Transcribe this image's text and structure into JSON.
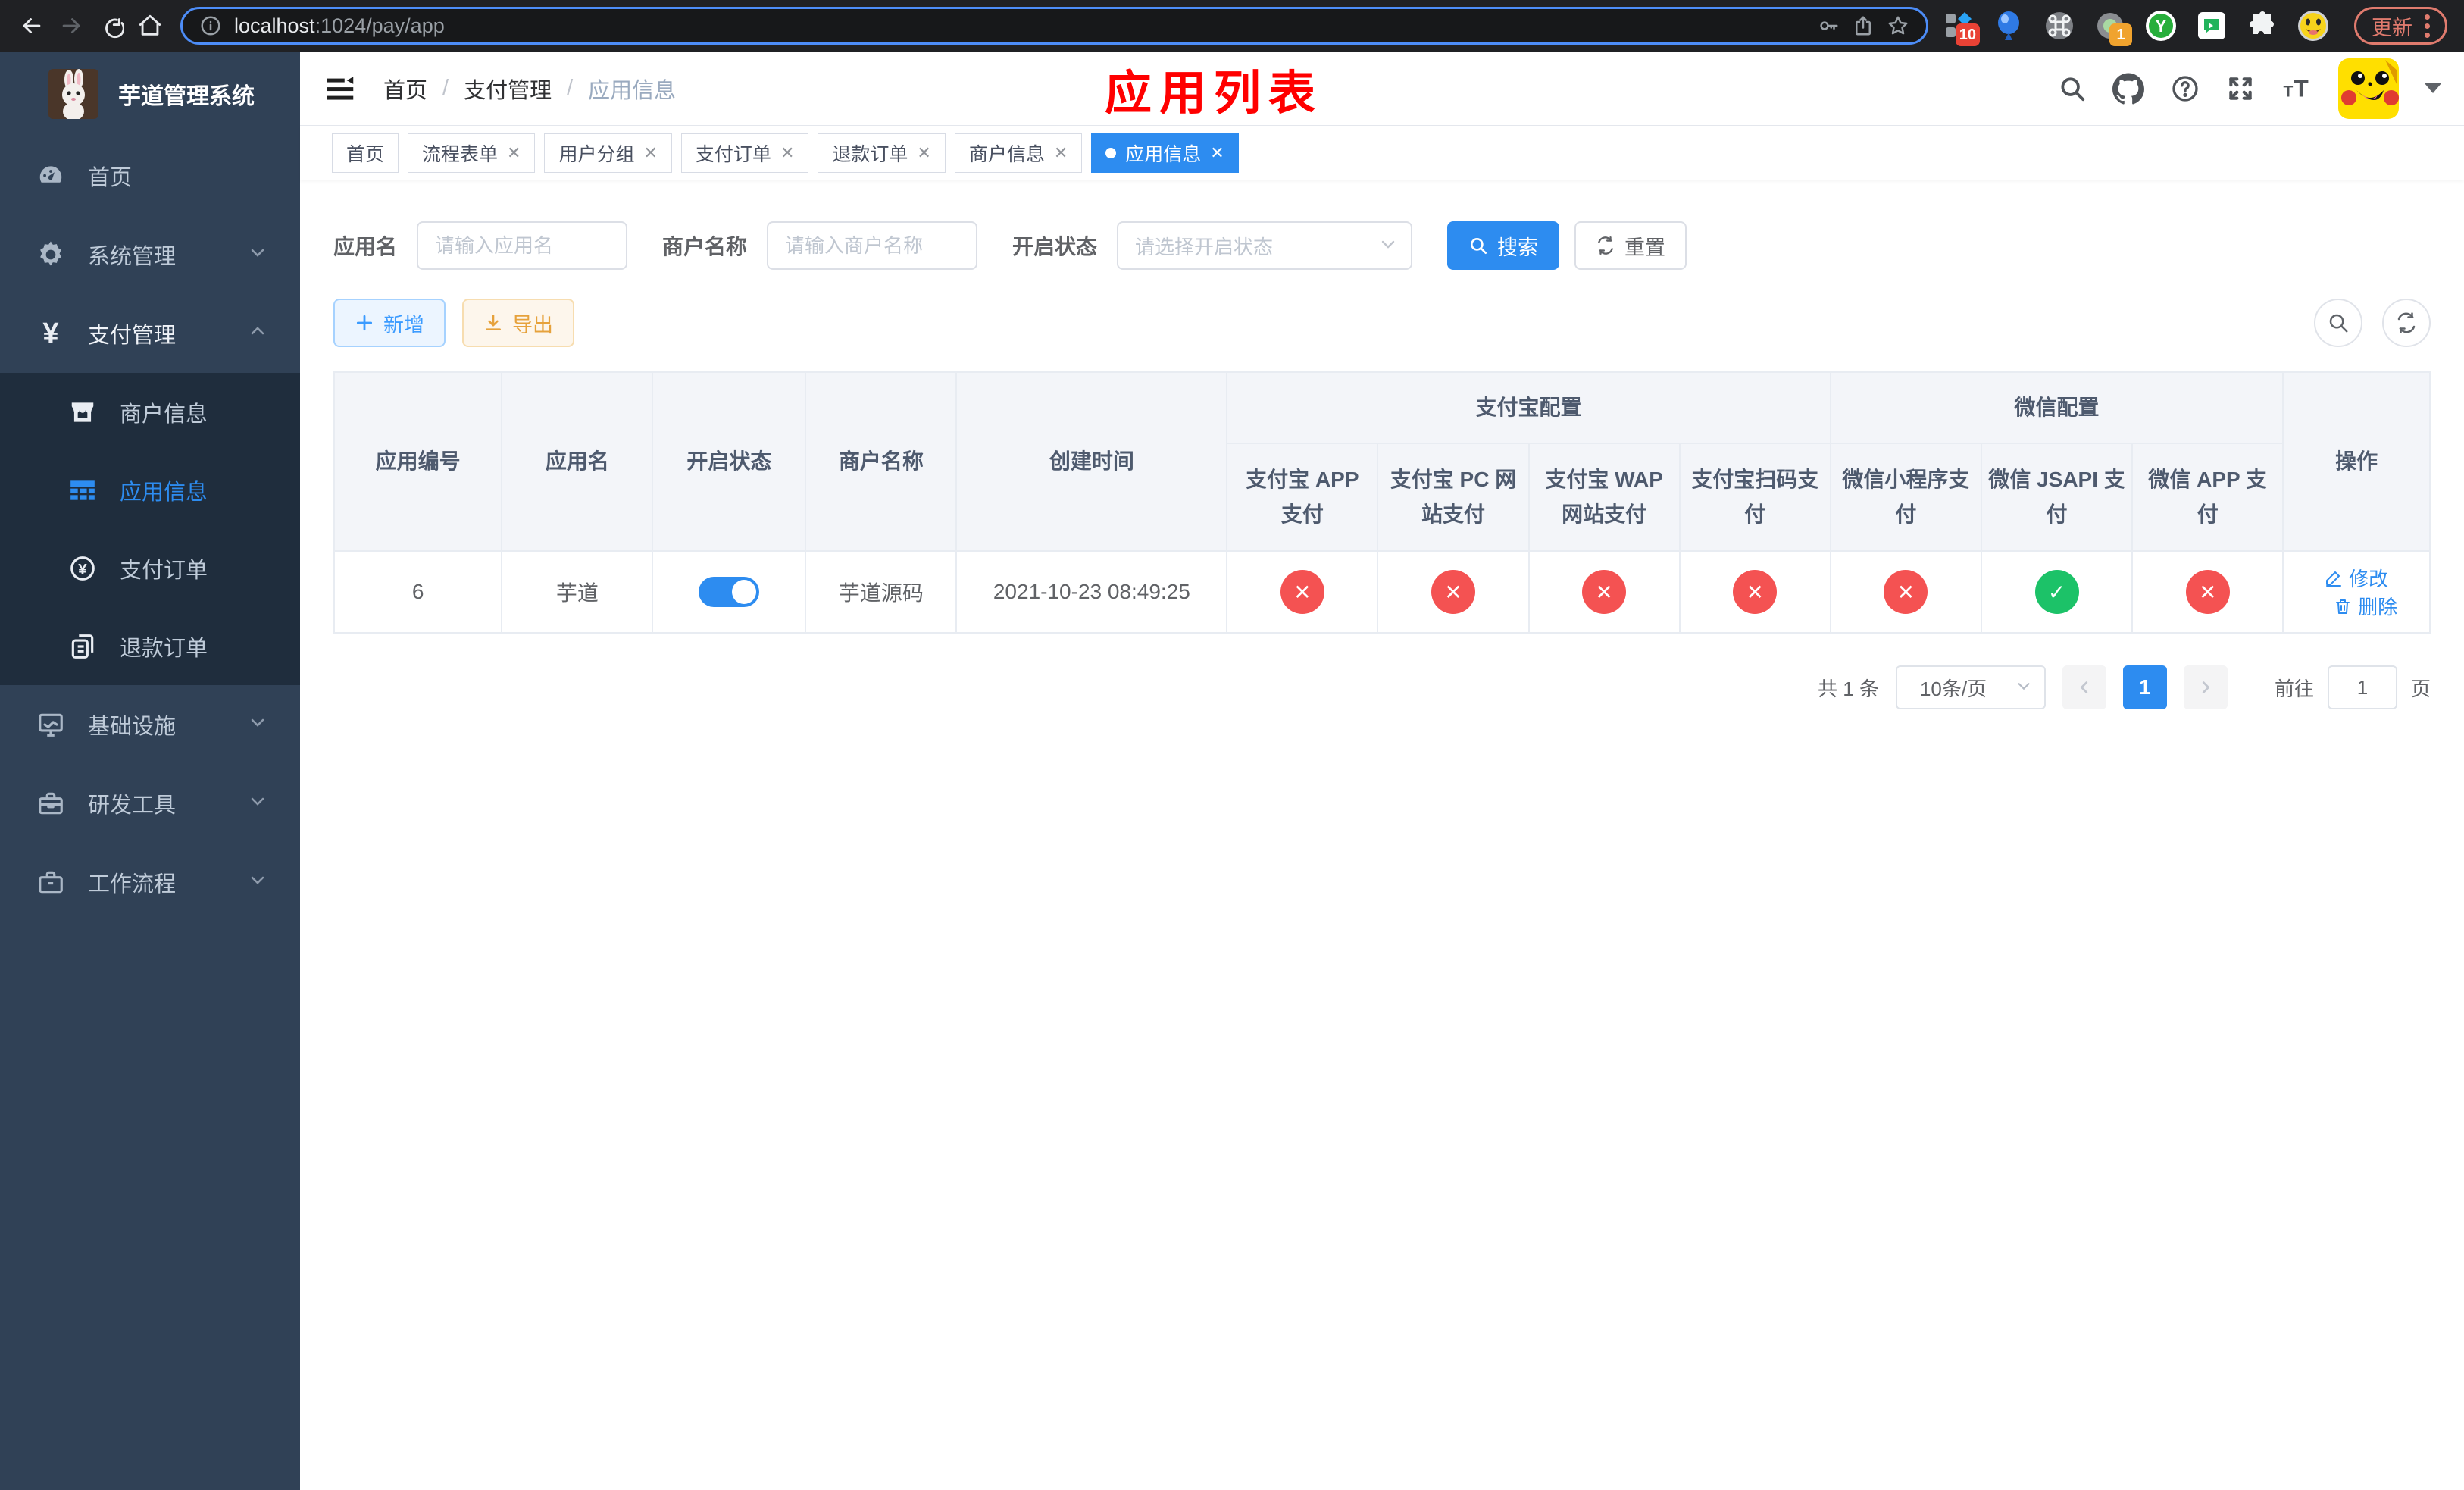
{
  "browser": {
    "url_host": "localhost",
    "url_rest": ":1024/pay/app",
    "ext_badge_10": "10",
    "ext_badge_1": "1",
    "update_label": "更新"
  },
  "sidebar": {
    "title": "芋道管理系统",
    "menu": [
      {
        "label": "首页"
      },
      {
        "label": "系统管理"
      },
      {
        "label": "支付管理"
      },
      {
        "label": "商户信息"
      },
      {
        "label": "应用信息"
      },
      {
        "label": "支付订单"
      },
      {
        "label": "退款订单"
      },
      {
        "label": "基础设施"
      },
      {
        "label": "研发工具"
      },
      {
        "label": "工作流程"
      }
    ]
  },
  "header": {
    "breadcrumb": [
      "首页",
      "支付管理",
      "应用信息"
    ],
    "annotation": "应用列表"
  },
  "tabs": [
    {
      "label": "首页"
    },
    {
      "label": "流程表单"
    },
    {
      "label": "用户分组"
    },
    {
      "label": "支付订单"
    },
    {
      "label": "退款订单"
    },
    {
      "label": "商户信息"
    },
    {
      "label": "应用信息"
    }
  ],
  "filters": {
    "app_name_label": "应用名",
    "app_name_placeholder": "请输入应用名",
    "merchant_label": "商户名称",
    "merchant_placeholder": "请输入商户名称",
    "status_label": "开启状态",
    "status_placeholder": "请选择开启状态",
    "search_label": "搜索",
    "reset_label": "重置"
  },
  "toolbar": {
    "add_label": "新增",
    "export_label": "导出"
  },
  "table": {
    "columns": [
      "应用编号",
      "应用名",
      "开启状态",
      "商户名称",
      "创建时间",
      "操作"
    ],
    "groups": [
      "支付宝配置",
      "微信配置"
    ],
    "sub_columns": [
      "支付宝 APP 支付",
      "支付宝 PC 网站支付",
      "支付宝 WAP 网站支付",
      "支付宝扫码支付",
      "微信小程序支付",
      "微信 JSAPI 支付",
      "微信 APP 支付"
    ],
    "row": {
      "id": "6",
      "name": "芋道",
      "enabled": true,
      "merchant": "芋道源码",
      "created_at": "2021-10-23 08:49:25",
      "channels": [
        false,
        false,
        false,
        false,
        false,
        true,
        false
      ],
      "edit_label": "修改",
      "delete_label": "删除"
    }
  },
  "pagination": {
    "total": "共 1 条",
    "page_size": "10条/页",
    "current": "1",
    "goto_label": "前往",
    "goto_value": "1",
    "unit": "页"
  }
}
